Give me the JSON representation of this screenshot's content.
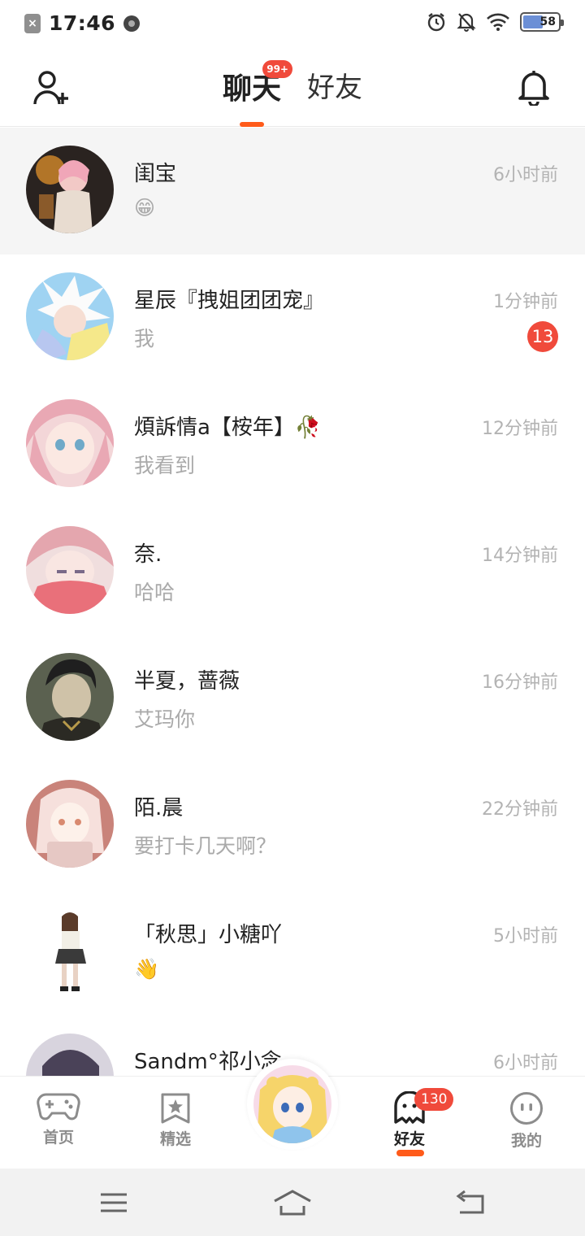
{
  "status_bar": {
    "time": "17:46",
    "battery": "58"
  },
  "header": {
    "tabs": [
      {
        "label": "聊天",
        "badge": "99+"
      },
      {
        "label": "好友"
      }
    ]
  },
  "chats": [
    {
      "name": "闺宝",
      "preview": "😁",
      "time": "6小时前",
      "unread": ""
    },
    {
      "name": "星辰『拽姐团团宠』",
      "preview": "我",
      "time": "1分钟前",
      "unread": "13"
    },
    {
      "name": "煩訴情a【桉年】🥀",
      "preview": "我看到",
      "time": "12分钟前",
      "unread": ""
    },
    {
      "name": "奈.",
      "preview": "哈哈",
      "time": "14分钟前",
      "unread": ""
    },
    {
      "name": "半夏，蔷薇",
      "preview": "艾玛你",
      "time": "16分钟前",
      "unread": ""
    },
    {
      "name": "陌.晨",
      "preview": "要打卡几天啊？",
      "time": "22分钟前",
      "unread": ""
    },
    {
      "name": "「秋思」小糖吖",
      "preview": "👋",
      "time": "5小时前",
      "unread": ""
    },
    {
      "name": "Sandm°祁小念",
      "preview": "",
      "time": "6小时前",
      "unread": ""
    }
  ],
  "bottom_nav": {
    "items": [
      {
        "label": "首页"
      },
      {
        "label": "精选"
      },
      {
        "label": "好友",
        "badge": "130"
      },
      {
        "label": "我的"
      }
    ]
  },
  "colors": {
    "accent": "#ff5b1a",
    "badge": "#f04a3b",
    "muted_text": "#aaaaaa"
  }
}
